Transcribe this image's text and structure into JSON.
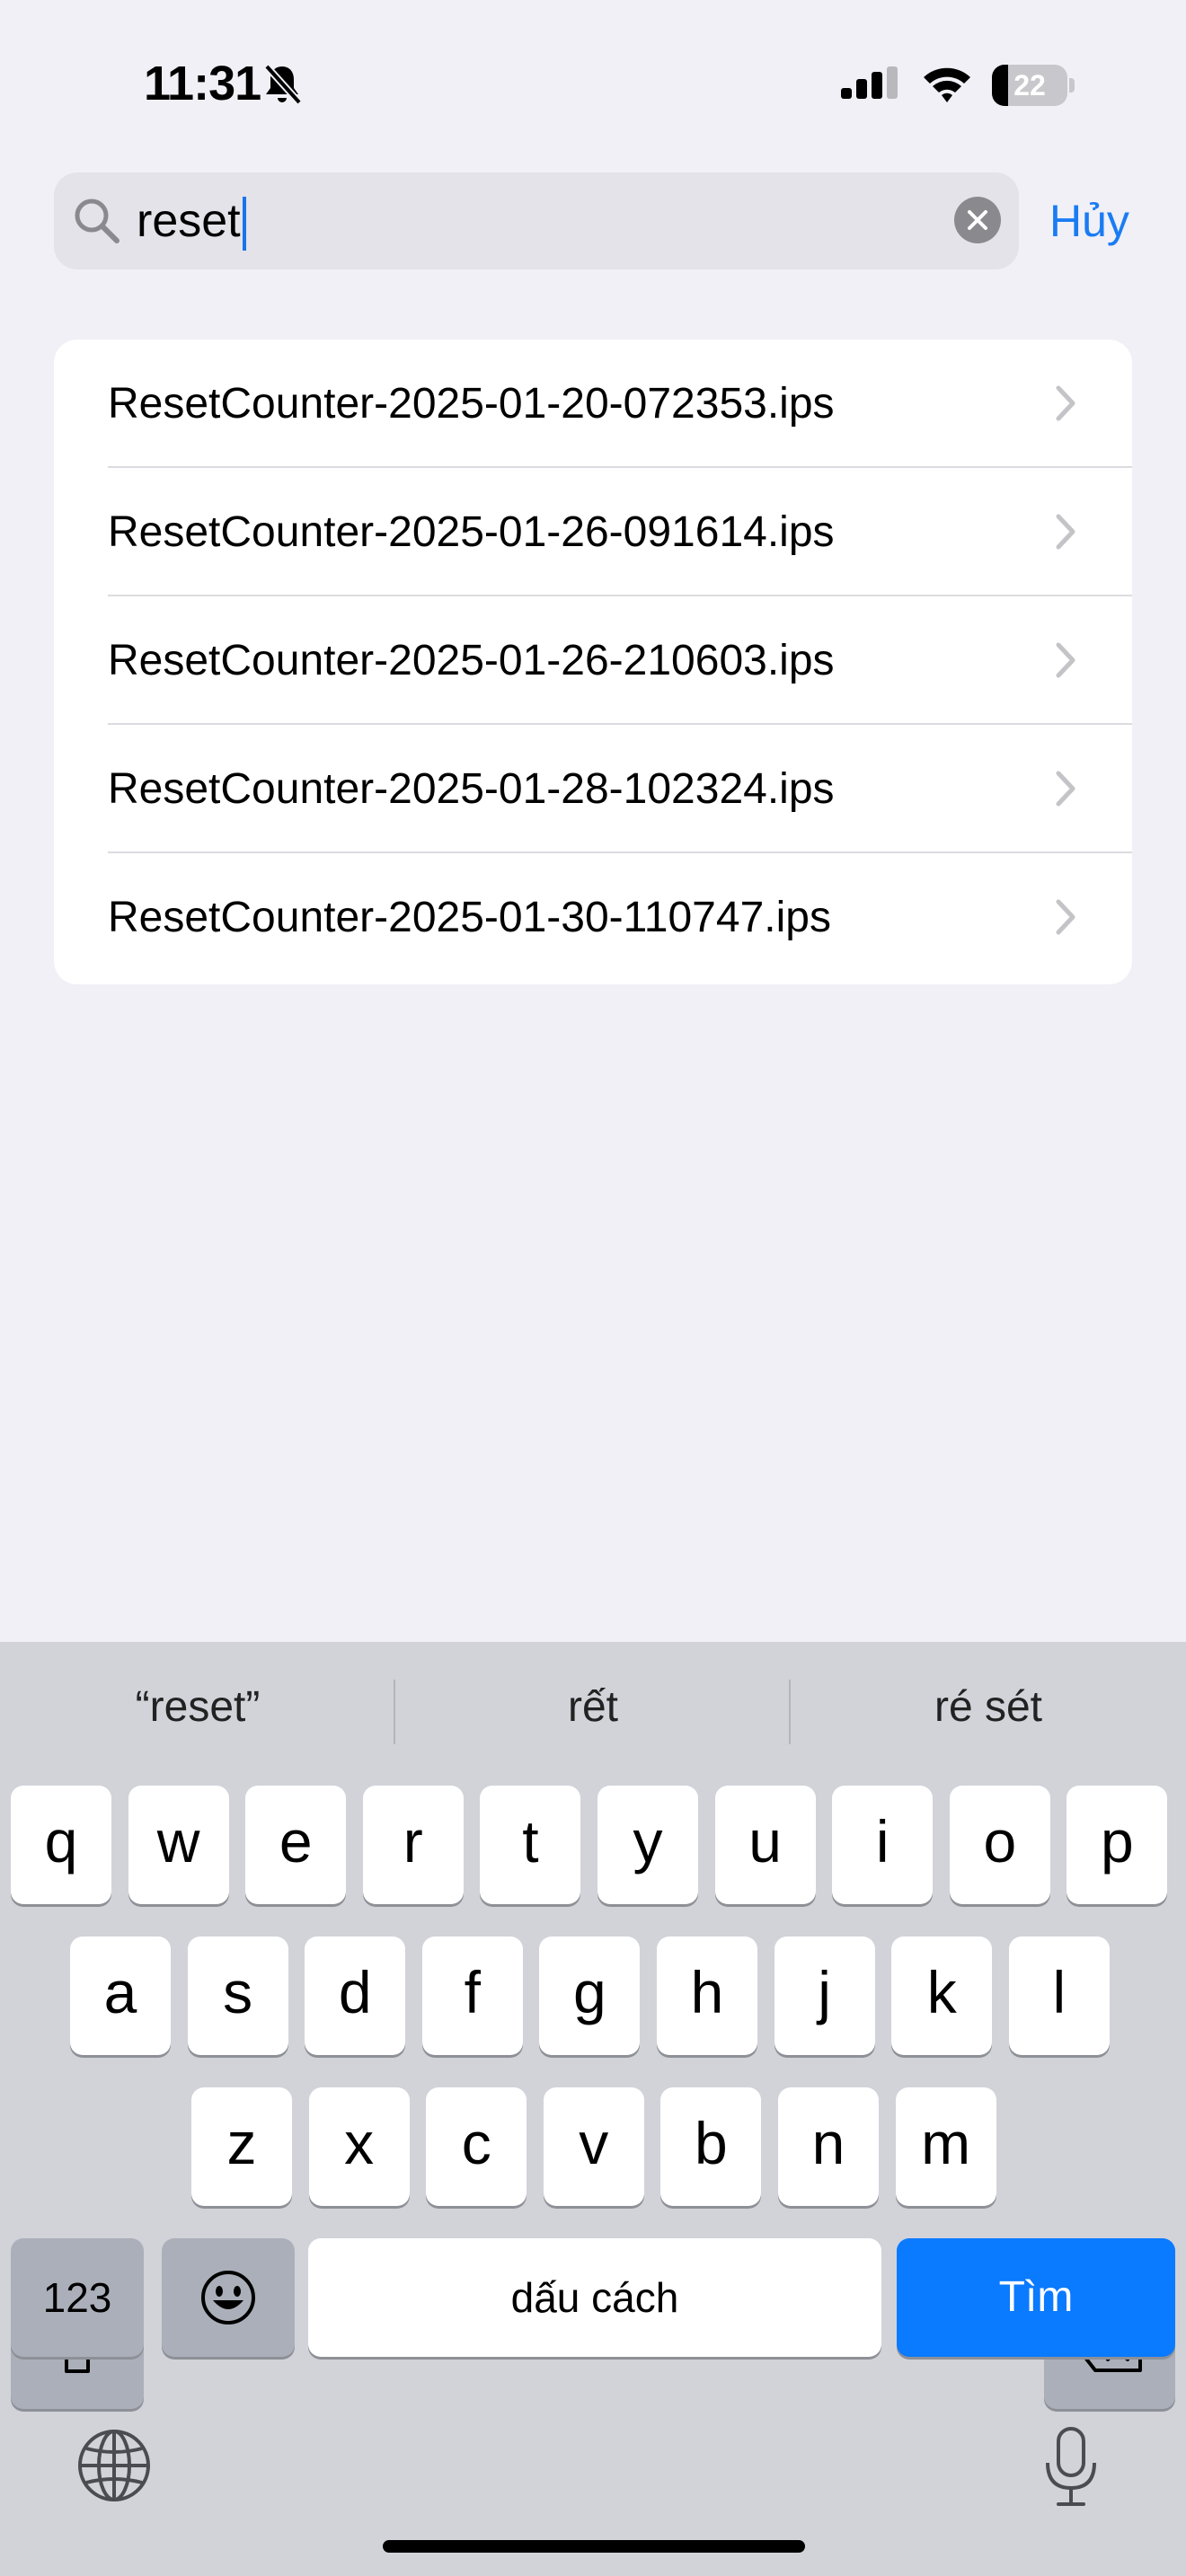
{
  "status_bar": {
    "time": "11:31",
    "battery": "22",
    "battery_level": 0.22
  },
  "search": {
    "value": "reset",
    "cancel_label": "Hủy"
  },
  "results": [
    "ResetCounter-2025-01-20-072353.ips",
    "ResetCounter-2025-01-26-091614.ips",
    "ResetCounter-2025-01-26-210603.ips",
    "ResetCounter-2025-01-28-102324.ips",
    "ResetCounter-2025-01-30-110747.ips"
  ],
  "keyboard": {
    "suggestions": [
      "“reset”",
      "rết",
      "ré sét"
    ],
    "row1": [
      "q",
      "w",
      "e",
      "r",
      "t",
      "y",
      "u",
      "i",
      "o",
      "p"
    ],
    "row2": [
      "a",
      "s",
      "d",
      "f",
      "g",
      "h",
      "j",
      "k",
      "l"
    ],
    "row3": [
      "z",
      "x",
      "c",
      "v",
      "b",
      "n",
      "m"
    ],
    "numbers_label": "123",
    "space_label": "dấu cách",
    "return_label": "Tìm"
  },
  "colors": {
    "accent": "#0a7aff",
    "background": "#f0f0f6"
  }
}
